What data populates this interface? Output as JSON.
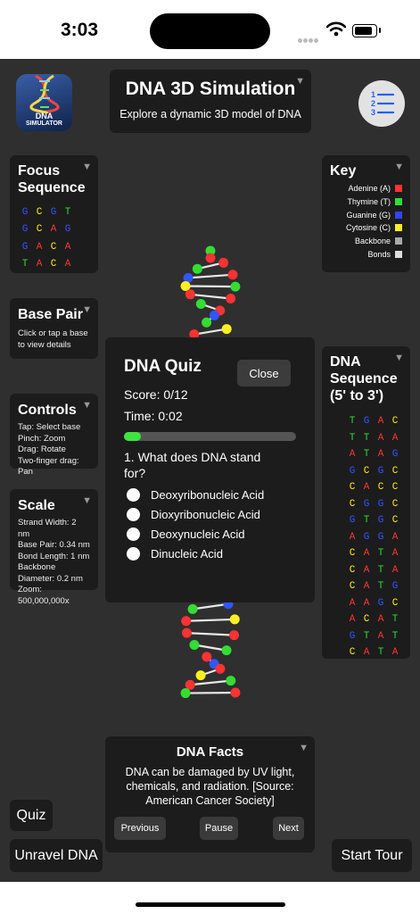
{
  "status": {
    "time": "3:03"
  },
  "header": {
    "title": "DNA 3D Simulation",
    "subtitle": "Explore a dynamic 3D model of DNA"
  },
  "logo": {
    "line1": "DNA",
    "line2": "SIMULATOR"
  },
  "focus": {
    "title": "Focus Sequence",
    "rows": [
      [
        "G",
        "C",
        "G",
        "T"
      ],
      [
        "G",
        "C",
        "A",
        "G"
      ],
      [
        "G",
        "A",
        "C",
        "A"
      ],
      [
        "T",
        "A",
        "C",
        "A"
      ]
    ]
  },
  "basepair": {
    "title": "Base Pair",
    "text": "Click or tap a base to view details"
  },
  "controls": {
    "title": "Controls",
    "lines": [
      "Tap: Select base",
      "Pinch: Zoom",
      "Drag: Rotate",
      "Two-finger drag: Pan"
    ]
  },
  "scale": {
    "title": "Scale",
    "lines": [
      "Strand Width: 2 nm",
      "Base Pair: 0.34 nm",
      "Bond Length: 1 nm",
      "Backbone Diameter: 0.2 nm",
      "Zoom: 500,000,000x"
    ]
  },
  "key": {
    "title": "Key",
    "items": [
      {
        "label": "Adenine (A)",
        "color": "#ff3333"
      },
      {
        "label": "Thymine (T)",
        "color": "#33dd33"
      },
      {
        "label": "Guanine (G)",
        "color": "#3344ff"
      },
      {
        "label": "Cytosine (C)",
        "color": "#ffee22"
      },
      {
        "label": "Backbone",
        "color": "#aaaaaa"
      },
      {
        "label": "Bonds",
        "color": "#dddddd"
      }
    ]
  },
  "sequence": {
    "title": "DNA Sequence (5' to 3')",
    "rows": [
      [
        "T",
        "G",
        "A",
        "C"
      ],
      [
        "T",
        "T",
        "A",
        "A"
      ],
      [
        "A",
        "T",
        "A",
        "G"
      ],
      [
        "G",
        "C",
        "G",
        "C"
      ],
      [
        "C",
        "A",
        "C",
        "C"
      ],
      [
        "C",
        "G",
        "G",
        "C"
      ],
      [
        "G",
        "T",
        "G",
        "C"
      ],
      [
        "A",
        "G",
        "G",
        "A"
      ],
      [
        "C",
        "A",
        "T",
        "A"
      ],
      [
        "C",
        "A",
        "T",
        "A"
      ],
      [
        "C",
        "A",
        "T",
        "G"
      ],
      [
        "A",
        "A",
        "G",
        "C"
      ],
      [
        "A",
        "C",
        "A",
        "T"
      ],
      [
        "G",
        "T",
        "A",
        "T"
      ],
      [
        "C",
        "A",
        "T",
        "A"
      ]
    ]
  },
  "base_colors": {
    "A": "#ff3333",
    "T": "#33dd33",
    "G": "#3355ff",
    "C": "#ffee22"
  },
  "quiz": {
    "title": "DNA Quiz",
    "close": "Close",
    "score": "Score: 0/12",
    "time": "Time: 0:02",
    "progress": 0.1,
    "question": "1. What does DNA stand for?",
    "options": [
      "Deoxyribonucleic Acid",
      "Dioxyribonucleic Acid",
      "Deoxynucleic Acid",
      "Dinucleic Acid"
    ]
  },
  "facts": {
    "title": "DNA Facts",
    "text": "DNA can be damaged by UV light, chemicals, and radiation. [Source: American Cancer Society]",
    "previous": "Previous",
    "pause": "Pause",
    "next": "Next"
  },
  "buttons": {
    "quiz": "Quiz",
    "unravel": "Unravel DNA",
    "tour": "Start Tour"
  }
}
